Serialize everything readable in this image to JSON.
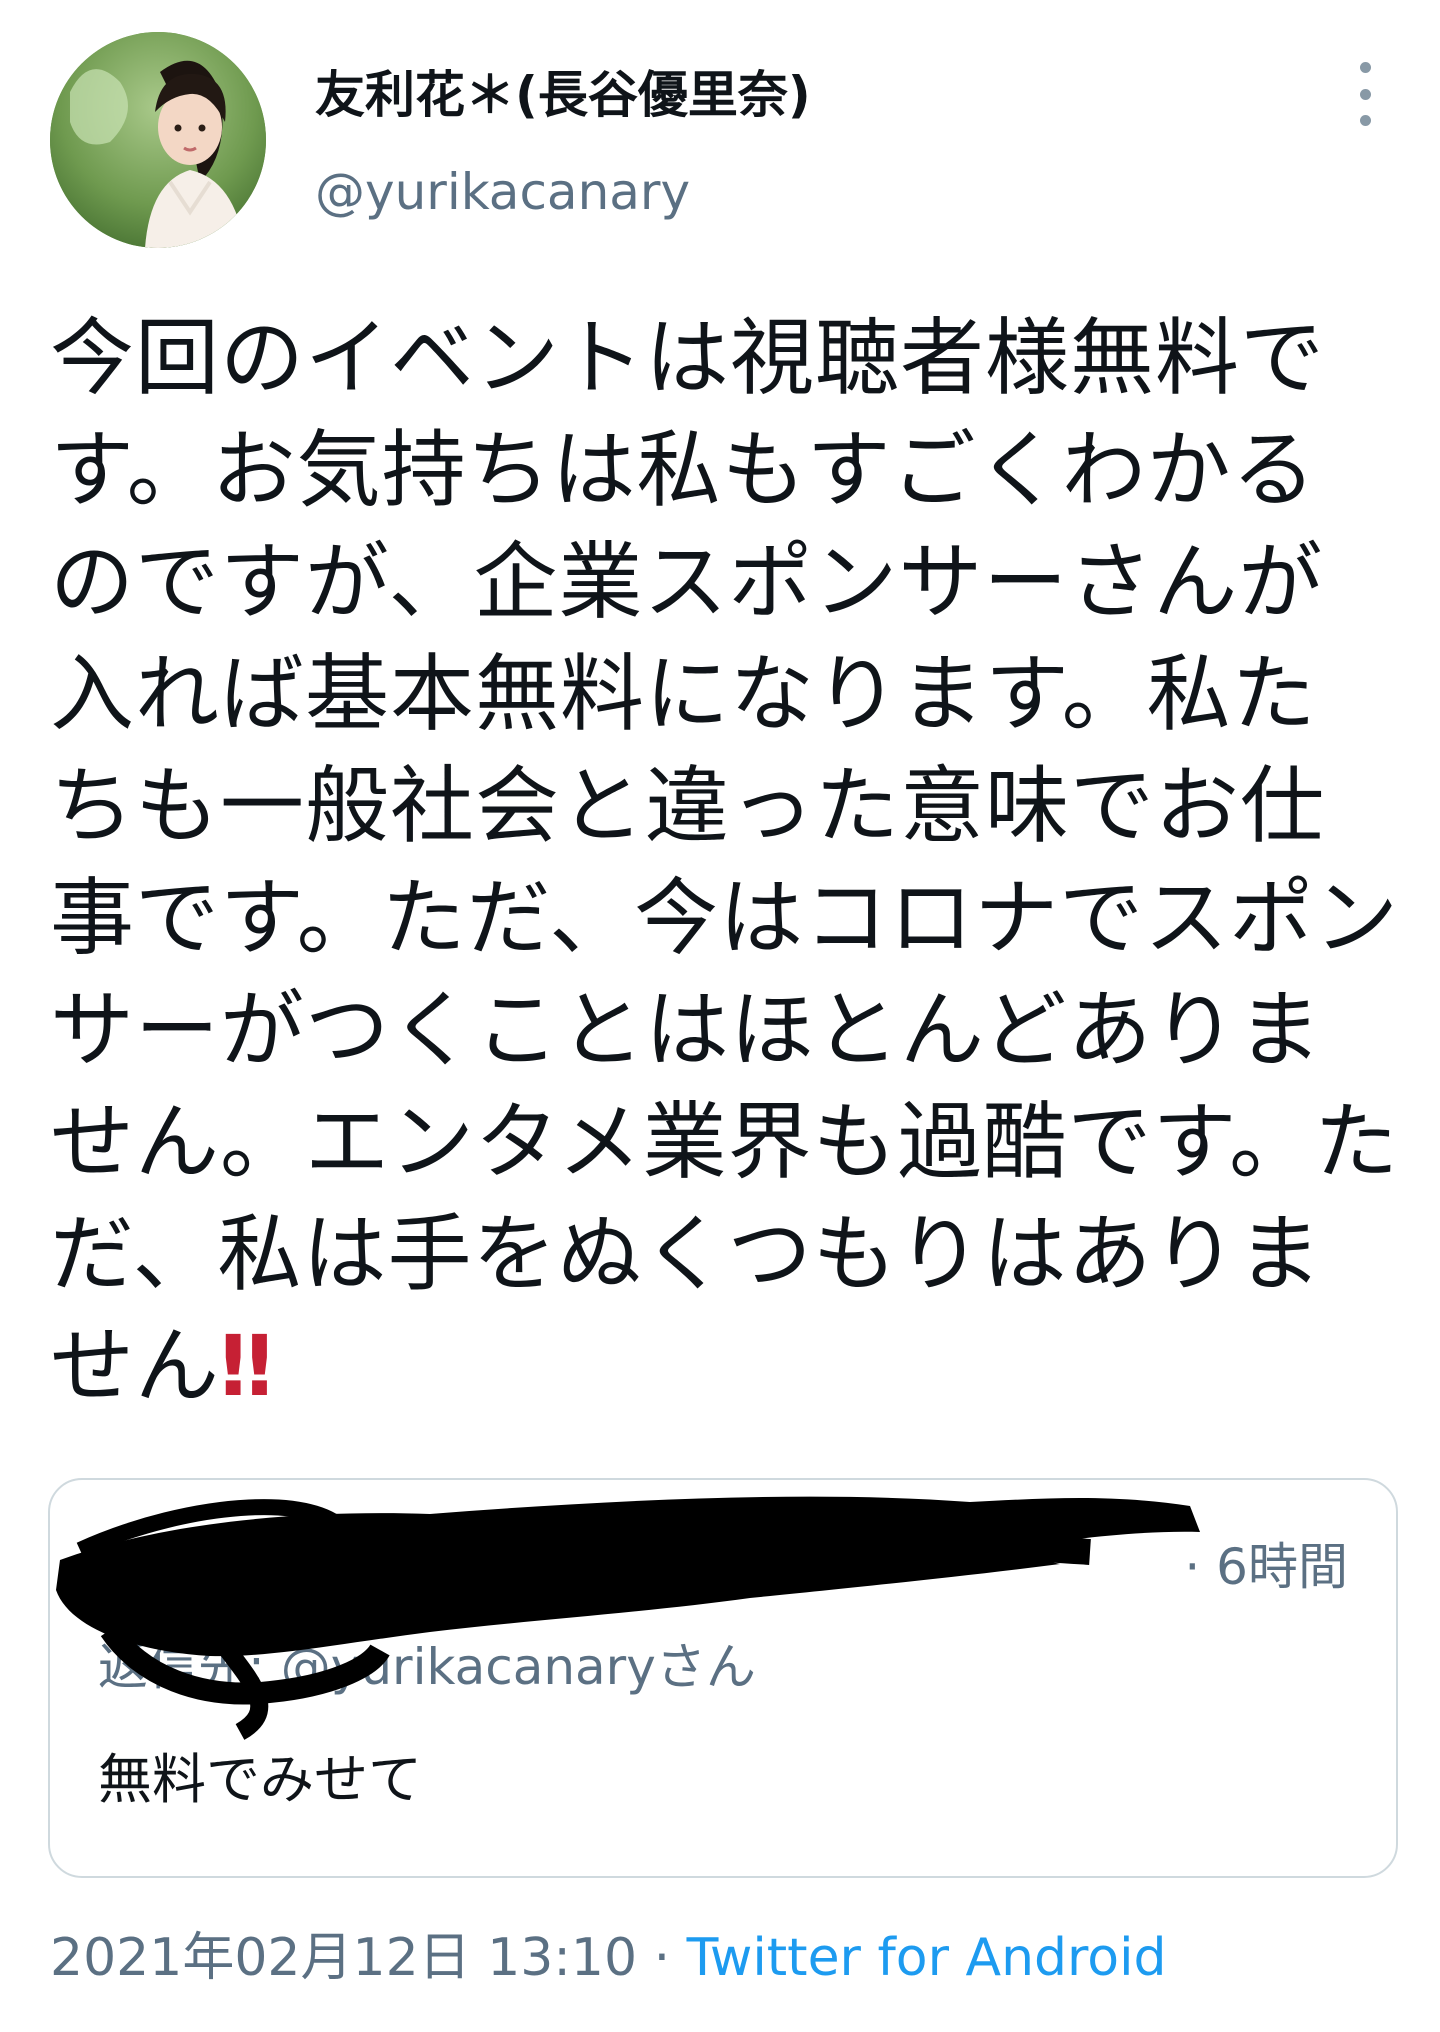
{
  "tweet": {
    "author": {
      "display_name": "友利花＊(長谷優里奈)",
      "handle": "@yurikacanary",
      "avatar_icon": "profile-photo-avatar"
    },
    "more_icon": "vertical-dots-icon",
    "text": "今回のイベントは視聴者様無料です。お気持ちは私もすごくわかるのですが、企業スポンサーさんが入れば基本無料になります。私たちも一般社会と違った意味でお仕事です。ただ、今はコロナでスポンサーがつくことはほとんどありません。エンタメ業界も過酷です。ただ、私は手をぬくつもりはありません",
    "emphasis_emoji": "‼",
    "reply_card": {
      "time": "· 6時間",
      "reply_to_prefix": "返信先:",
      "reply_to_handle": "@yurikacanaryさん",
      "body": "無料でみせて"
    },
    "meta": {
      "date": "2021年02月12日 13:10",
      "separator": "·",
      "source": "Twitter for Android"
    }
  },
  "colors": {
    "text_primary": "#0f1419",
    "text_secondary": "#5b7083",
    "link": "#1d9bf0",
    "emoji_red": "#c62034",
    "card_border": "#cfd9de"
  }
}
